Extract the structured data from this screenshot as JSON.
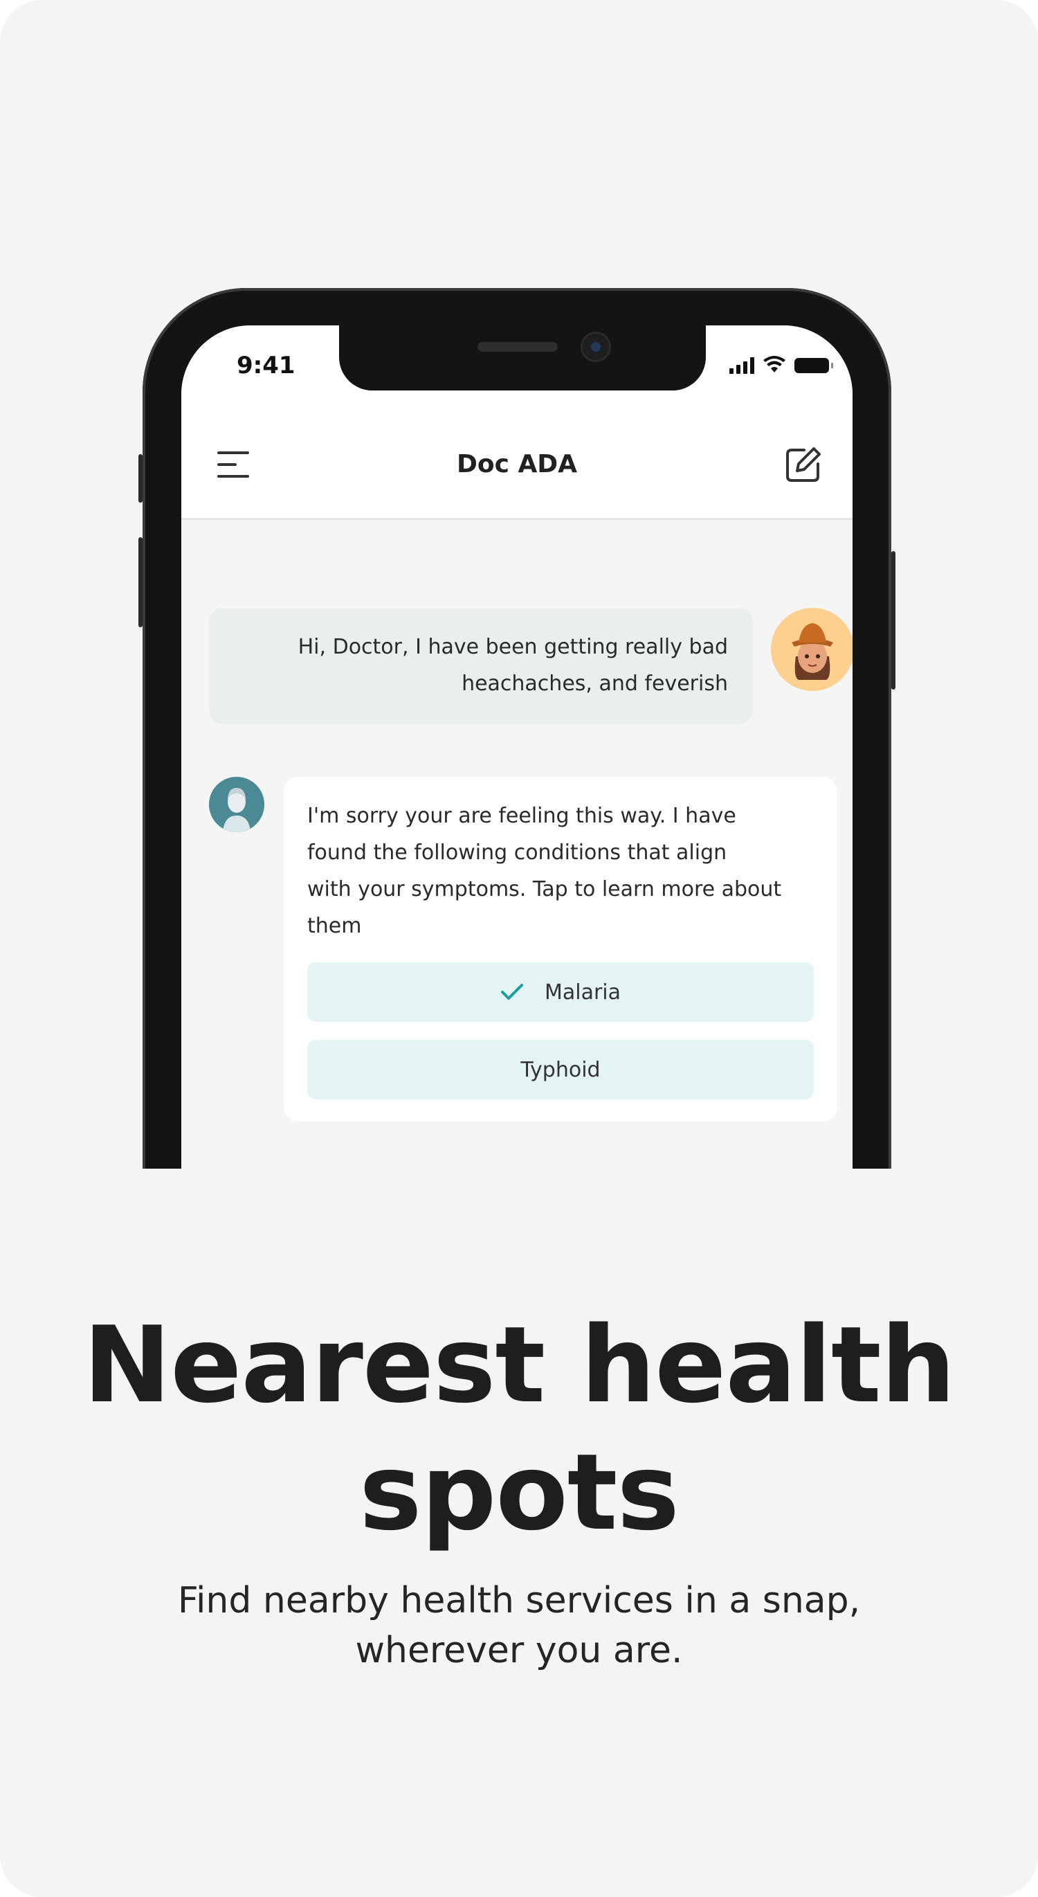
{
  "status_bar": {
    "time": "9:41"
  },
  "app_header": {
    "title": "Doc ADA",
    "menu_icon": "menu-icon",
    "edit_icon": "edit-icon"
  },
  "chat": {
    "user_message": {
      "line1": "Hi, Doctor, I have been getting really bad",
      "line2": "heachaches, and feverish"
    },
    "bot_message": {
      "line1": "I'm sorry your are feeling this way. I have",
      "line2": "found the following conditions that align",
      "line3": "with your symptoms. Tap to learn more about",
      "line4": "them"
    },
    "options": [
      {
        "label": "Malaria",
        "selected": true
      },
      {
        "label": "Typhoid",
        "selected": false
      }
    ]
  },
  "onboarding": {
    "headline_line1": "Nearest health",
    "headline_line2": "spots",
    "subtitle_line1": "Find nearby health services in a snap,",
    "subtitle_line2": "wherever you are."
  },
  "colors": {
    "background": "#f4f4f4",
    "chip": "#e4f3f3",
    "accent": "#1a9ea0",
    "user_avatar_bg": "#fdd08f"
  }
}
